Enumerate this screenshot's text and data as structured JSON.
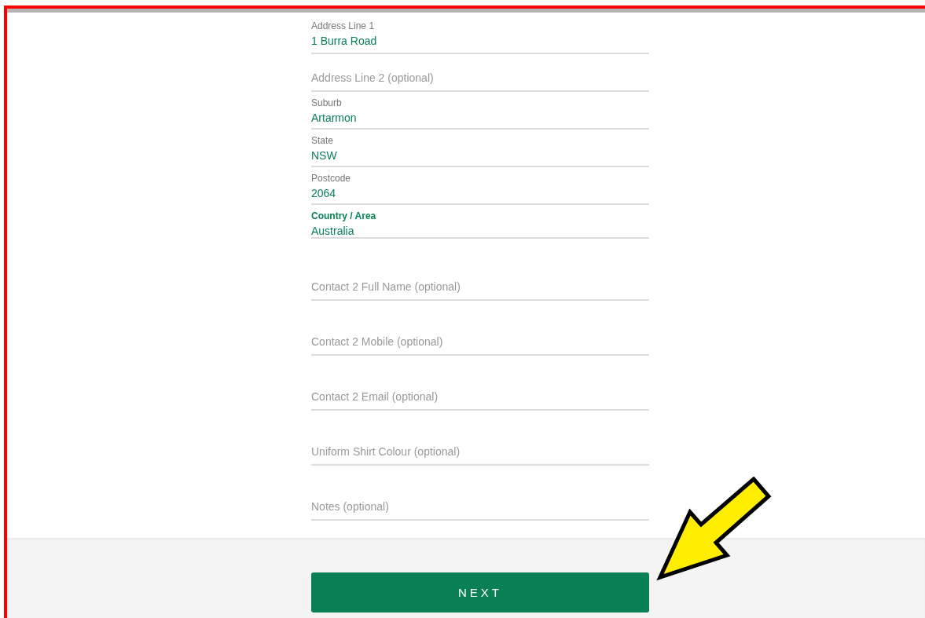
{
  "address_fields": [
    {
      "label": "Address Line 1",
      "value": "1 Burra Road",
      "focused": false
    },
    {
      "placeholder": "Address Line 2 (optional)"
    },
    {
      "label": "Suburb",
      "value": "Artarmon",
      "focused": false
    },
    {
      "label": "State",
      "value": "NSW",
      "focused": false
    },
    {
      "label": "Postcode",
      "value": "2064",
      "focused": false
    },
    {
      "label": "Country / Area",
      "value": "Australia",
      "focused": true
    }
  ],
  "contact_fields": [
    {
      "placeholder": "Contact 2 Full Name (optional)"
    },
    {
      "placeholder": "Contact 2 Mobile (optional)"
    },
    {
      "placeholder": "Contact 2 Email (optional)"
    },
    {
      "placeholder": "Uniform Shirt Colour (optional)"
    },
    {
      "placeholder": "Notes (optional)"
    }
  ],
  "next_button": "NEXT"
}
